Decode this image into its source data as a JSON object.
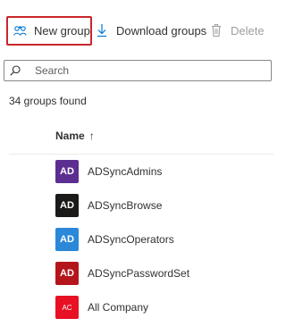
{
  "toolbar": {
    "new_group_label": "New group",
    "download_label": "Download groups",
    "delete_label": "Delete"
  },
  "search": {
    "placeholder": "Search",
    "value": ""
  },
  "result_count": "34 groups found",
  "table": {
    "column_name": "Name",
    "sort_indicator": "↑",
    "rows": [
      {
        "initials": "AD",
        "name": "ADSyncAdmins",
        "color": "#5c2e91"
      },
      {
        "initials": "AD",
        "name": "ADSyncBrowse",
        "color": "#1b1a19"
      },
      {
        "initials": "AD",
        "name": "ADSyncOperators",
        "color": "#2b88d8"
      },
      {
        "initials": "AD",
        "name": "ADSyncPasswordSet",
        "color": "#b4151b"
      },
      {
        "initials": "AC",
        "name": "All Company",
        "color": "#e81123"
      }
    ]
  },
  "colors": {
    "accent": "#0078d4",
    "highlight_border": "#c8262b",
    "disabled_text": "#a19f9d"
  },
  "icons": {
    "new_group": "people-add-icon",
    "download": "download-icon",
    "delete": "trash-icon",
    "search": "search-icon"
  }
}
